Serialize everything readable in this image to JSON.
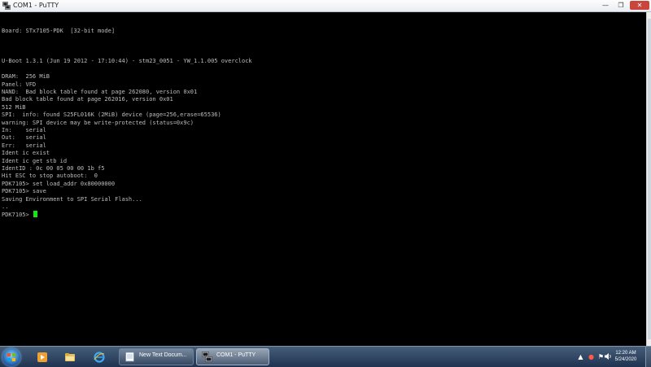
{
  "window": {
    "title": "COM1 - PuTTY",
    "minimize_glyph": "—",
    "maximize_glyph": "❐",
    "close_glyph": "✕"
  },
  "console": {
    "lines": [
      "",
      "",
      "Board: STx7105-PDK  [32-bit mode]",
      "",
      "",
      "",
      "U-Boot 1.3.1 (Jun 19 2012 - 17:10:44) - stm23_0051 - YW_1.1.005 overclock",
      "",
      "DRAM:  256 MiB",
      "Panel: VFD",
      "NAND:  Bad block table found at page 262080, version 0x01",
      "Bad block table found at page 262016, version 0x01",
      "512 MiB",
      "SPI:  info: found S25FL016K (2MiB) device (page=256,erase=65536)",
      "warning: SPI device may be write-protected (status=0x9c)",
      "In:    serial",
      "Out:   serial",
      "Err:   serial",
      "Ident ic exist",
      "Ident ic get stb id",
      "IdentID : 0c 00 05 00 00 1b f5",
      "Hit ESC to stop autoboot:  0",
      "PDK7105> set load_addr 0x80000000",
      "PDK7105> save",
      "Saving Environment to SPI Serial Flash...",
      "..",
      "PDK7105> "
    ]
  },
  "taskbar": {
    "tasks": [
      {
        "label": "New Text Docum..."
      },
      {
        "label": "COM1 - PuTTY"
      }
    ],
    "clock": {
      "time": "12:20 AM",
      "date": "5/24/2020"
    }
  },
  "icons": {
    "start": "windows-start-orb",
    "quick_launch": [
      "media-player-icon",
      "explorer-icon",
      "internet-explorer-icon"
    ],
    "tray": [
      "chevron-up-icon",
      "network-alert-icon",
      "flag-icon",
      "volume-icon"
    ]
  },
  "colors": {
    "console_bg": "#000000",
    "console_text": "#bdbdbd",
    "cursor": "#14e814",
    "close_button": "#c9463d",
    "taskbar": "#2b4363"
  }
}
